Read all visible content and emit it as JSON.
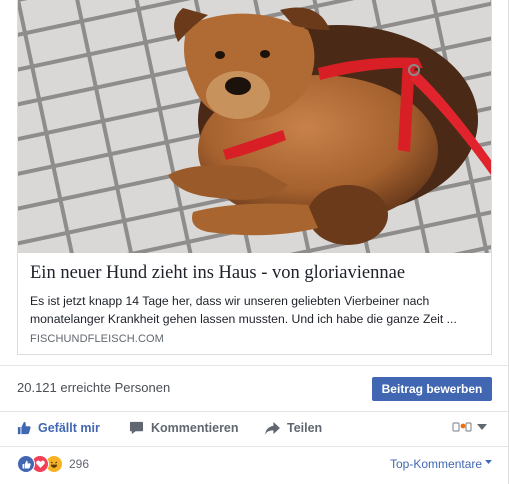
{
  "link_card": {
    "image": "dog-photo",
    "title": "Ein neuer Hund zieht ins Haus - von gloriaviennae",
    "description": "Es ist jetzt knapp 14 Tage her, dass wir unseren geliebten Vierbeiner nach monatelanger Krankheit gehen lassen mussten. Und ich habe die ganze Zeit ...",
    "domain": "FISCHUNDFLEISCH.COM"
  },
  "insights": {
    "reach_text": "20.121 erreichte Personen",
    "boost_label": "Beitrag bewerben"
  },
  "actions": {
    "like_label": "Gefällt mir",
    "comment_label": "Kommentieren",
    "share_label": "Teilen"
  },
  "reactions": {
    "types": [
      "like",
      "love",
      "haha"
    ],
    "count": "296",
    "sort_label": "Top-Kommentare"
  },
  "colors": {
    "accent": "#4267b2",
    "love": "#f33e58",
    "haha": "#f7b125"
  }
}
